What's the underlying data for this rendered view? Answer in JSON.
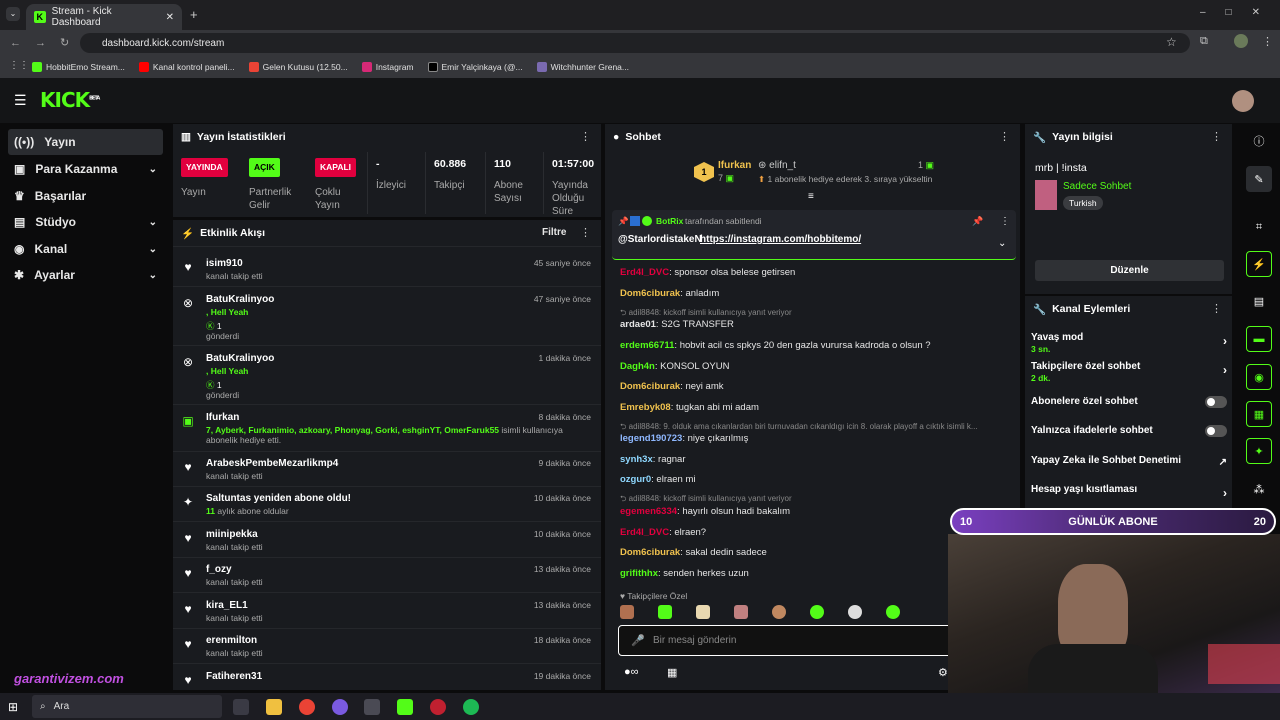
{
  "browser": {
    "tab_title": "Stream - Kick Dashboard",
    "url": "dashboard.kick.com/stream",
    "bookmarks": [
      "HobbitEmo Stream...",
      "Kanal kontrol paneli...",
      "Gelen Kutusu (12.50...",
      "Instagram",
      "Emir Yalçinkaya (@...",
      "Witchhunter Grena..."
    ]
  },
  "header": {
    "logo": "KICK",
    "beta": "BETA"
  },
  "sidebar": {
    "items": [
      {
        "label": "Yayın",
        "icon": "broadcast-icon"
      },
      {
        "label": "Para Kazanma",
        "icon": "money-icon"
      },
      {
        "label": "Başarılar",
        "icon": "trophy-icon"
      },
      {
        "label": "Stüdyo",
        "icon": "studio-icon"
      },
      {
        "label": "Kanal",
        "icon": "channel-icon"
      },
      {
        "label": "Ayarlar",
        "icon": "gear-icon"
      }
    ]
  },
  "stats": {
    "title": "Yayın İstatistikleri",
    "items": [
      {
        "tag": "YAYINDA",
        "label": "Yayın",
        "color": "#e1003e"
      },
      {
        "tag": "AÇIK",
        "label": "Partnerlik Gelir",
        "color": "#53fc18"
      },
      {
        "tag": "KAPALI",
        "label": "Çoklu Yayın",
        "color": "#e1003e"
      },
      {
        "value": "-",
        "label": "İzleyici"
      },
      {
        "value": "60.886",
        "label": "Takipçi"
      },
      {
        "value": "110",
        "label": "Abone Sayısı"
      },
      {
        "value": "01:57:00",
        "label": "Yayında Olduğu Süre"
      }
    ]
  },
  "activity": {
    "title": "Etkinlik Akışı",
    "filter": "Filtre",
    "events": [
      {
        "icon": "heart",
        "name": "isim910",
        "sub": "kanalı takip etti",
        "time": "45 saniye önce"
      },
      {
        "icon": "kick",
        "name": "BatuKralinyoo",
        "msg": ", Hell Yeah",
        "count": "1",
        "sub": "gönderdi",
        "time": "47 saniye önce"
      },
      {
        "icon": "kick",
        "name": "BatuKralinyoo",
        "msg": ", Hell Yeah",
        "count": "1",
        "sub": "gönderdi",
        "time": "1 dakika önce"
      },
      {
        "icon": "gift",
        "name": "Ifurkan",
        "msg": "7, Ayberk, Furkanimio, azkoary, Phonyag, Gorki, eshginYT, OmerFaruk55",
        "sub2": "isimli kullanıcıya abonelik hediye etti.",
        "time": "8 dakika önce"
      },
      {
        "icon": "heart",
        "name": "ArabeskPembeMezarlikmp4",
        "sub": "kanalı takip etti",
        "time": "9 dakika önce"
      },
      {
        "icon": "star",
        "name": "Saltuntas yeniden abone oldu!",
        "msg": "11",
        "sub2": "aylık abone oldular",
        "time": "10 dakika önce"
      },
      {
        "icon": "heart",
        "name": "miinipekka",
        "sub": "kanalı takip etti",
        "time": "10 dakika önce"
      },
      {
        "icon": "heart",
        "name": "f_ozy",
        "sub": "kanalı takip etti",
        "time": "13 dakika önce"
      },
      {
        "icon": "heart",
        "name": "kira_EL1",
        "sub": "kanalı takip etti",
        "time": "13 dakika önce"
      },
      {
        "icon": "heart",
        "name": "erenmilton",
        "sub": "kanalı takip etti",
        "time": "18 dakika önce"
      },
      {
        "icon": "heart",
        "name": "Fatiheren31",
        "sub": "",
        "time": "19 dakika önce"
      }
    ]
  },
  "chat": {
    "title": "Sohbet",
    "top_gifter": {
      "rank": "1",
      "name": "Ifurkan",
      "count": "7",
      "recipient": "elifn_t",
      "recipient_count": "1",
      "note": "1 abonelik hediye ederek 3. sıraya yükseltin"
    },
    "pinned": {
      "bot": "BotRix",
      "by": "tarafından sabitlendi",
      "text": "@StarlordistakeN",
      "link": "https://instagram.com/hobbitemo/"
    },
    "messages": [
      {
        "user": "Erd4l_DVC",
        "color": "#e1003e",
        "text": "sponsor olsa belese getirsen"
      },
      {
        "user": "Dom6ciburak",
        "color": "#f0c24e",
        "text": "anladım"
      },
      {
        "reply": "adil8848: kickoff isimli kullanıcıya yanıt veriyor"
      },
      {
        "user": "ardae01",
        "color": "#e6e6e6",
        "text": "S2G TRANSFER"
      },
      {
        "user": "erdem66711",
        "color": "#53fc18",
        "text": "hobvit acil cs spkys 20 den gazla vurursa kadroda o olsun ?"
      },
      {
        "user": "Dagh4n",
        "color": "#53fc18",
        "text": "KONSOL OYUN"
      },
      {
        "user": "Dom6ciburak",
        "color": "#f0c24e",
        "text": "neyi amk"
      },
      {
        "user": "Emrebyk08",
        "color": "#f0c24e",
        "text": "tugkan abi mi adam"
      },
      {
        "reply": "adil8848: 9. olduk ama cıkanlardan biri turnuvadan cıkanldıgı icin 8. olarak playoff a cıktık isimli k..."
      },
      {
        "user": "legend190723",
        "color": "#8fb8ff",
        "text": "niye çıkarılmış"
      },
      {
        "user": "synh3x",
        "color": "#8fd8ff",
        "text": "ragnar"
      },
      {
        "user": "ozgur0",
        "color": "#8fd8ff",
        "text": "elraen mi"
      },
      {
        "reply": "adil8848: kickoff isimli kullanıcıya yanıt veriyor"
      },
      {
        "user": "egemen6334",
        "color": "#e1003e",
        "text": "hayırlı olsun hadi bakalım"
      },
      {
        "user": "Erd4l_DVC",
        "color": "#e1003e",
        "text": "elraen?"
      },
      {
        "user": "Dom6ciburak",
        "color": "#f0c24e",
        "text": "sakal dedin sadece"
      },
      {
        "user": "grifithhx",
        "color": "#53fc18",
        "text": "senden herkes uzun"
      }
    ],
    "followers_only": "Takipçilere Özel",
    "input_placeholder": "Bir mesaj gönderin"
  },
  "stream_info": {
    "title": "Yayın bilgisi",
    "stream_title": "mrb | !insta",
    "category": "Sadece Sohbet",
    "language": "Turkish",
    "edit": "Düzenle"
  },
  "channel_actions": {
    "title": "Kanal Eylemleri",
    "rows": [
      {
        "label": "Yavaş mod",
        "value": "3 sn.",
        "type": "arrow"
      },
      {
        "label": "Takipçilere özel sohbet",
        "value": "2 dk.",
        "type": "arrow"
      },
      {
        "label": "Abonelere özel sohbet",
        "type": "toggle"
      },
      {
        "label": "Yalnızca ifadelerle sohbet",
        "type": "toggle"
      },
      {
        "label": "Yapay Zeka ile Sohbet Denetimi",
        "type": "external"
      },
      {
        "label": "Hesap yaşı kısıtlaması",
        "type": "arrow"
      }
    ]
  },
  "overlay": {
    "left": "10",
    "label": "GÜNLÜK ABONE",
    "right": "20",
    "watermark": "garantivizem.com"
  },
  "taskbar": {
    "search": "Ara"
  }
}
